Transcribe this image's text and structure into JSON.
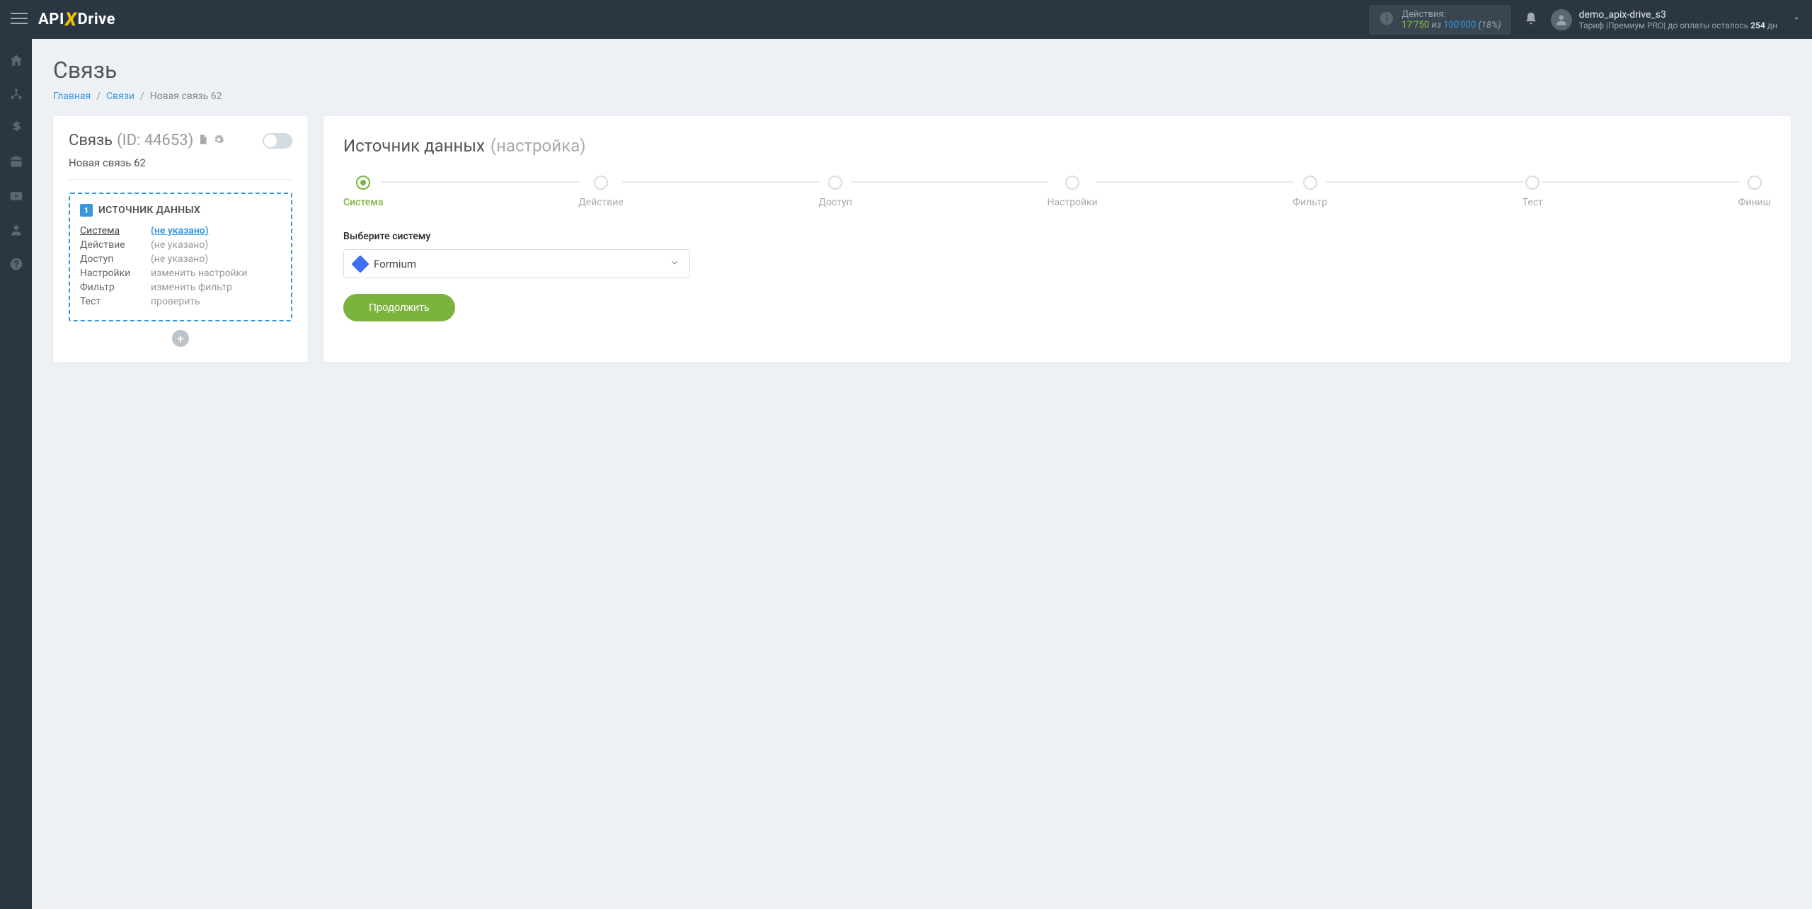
{
  "header": {
    "logo_pre": "API",
    "logo_x": "X",
    "logo_post": "Drive",
    "actions_label": "Действия:",
    "actions_used": "17'750",
    "actions_mid": " из ",
    "actions_total": "100'000",
    "actions_pct": " (18%)",
    "user_name": "demo_apix-drive_s3",
    "tariff_pre": "Тариф |Премиум PRO| до оплаты осталось ",
    "tariff_days": "254",
    "tariff_suf": " дн"
  },
  "page": {
    "title": "Связь",
    "breadcrumb": {
      "home": "Главная",
      "links": "Связи",
      "current": "Новая связь 62"
    }
  },
  "left": {
    "title": "Связь",
    "id_label": " (ID: 44653)",
    "conn_name": "Новая связь 62",
    "source_num": "1",
    "source_title": "ИСТОЧНИК ДАННЫХ",
    "rows": [
      {
        "label": "Система",
        "val": "(не указано)",
        "active": true,
        "link": true
      },
      {
        "label": "Действие",
        "val": "(не указано)",
        "active": false,
        "link": false
      },
      {
        "label": "Доступ",
        "val": "(не указано)",
        "active": false,
        "link": false
      },
      {
        "label": "Настройки",
        "val": "изменить настройки",
        "active": false,
        "link": false
      },
      {
        "label": "Фильтр",
        "val": "изменить фильтр",
        "active": false,
        "link": false
      },
      {
        "label": "Тест",
        "val": "проверить",
        "active": false,
        "link": false
      }
    ]
  },
  "right": {
    "title": "Источник данных",
    "subtitle": "(настройка)",
    "steps": [
      "Система",
      "Действие",
      "Доступ",
      "Настройки",
      "Фильтр",
      "Тест",
      "Финиш"
    ],
    "form_label": "Выберите систему",
    "select_value": "Formium",
    "continue": "Продолжить"
  }
}
